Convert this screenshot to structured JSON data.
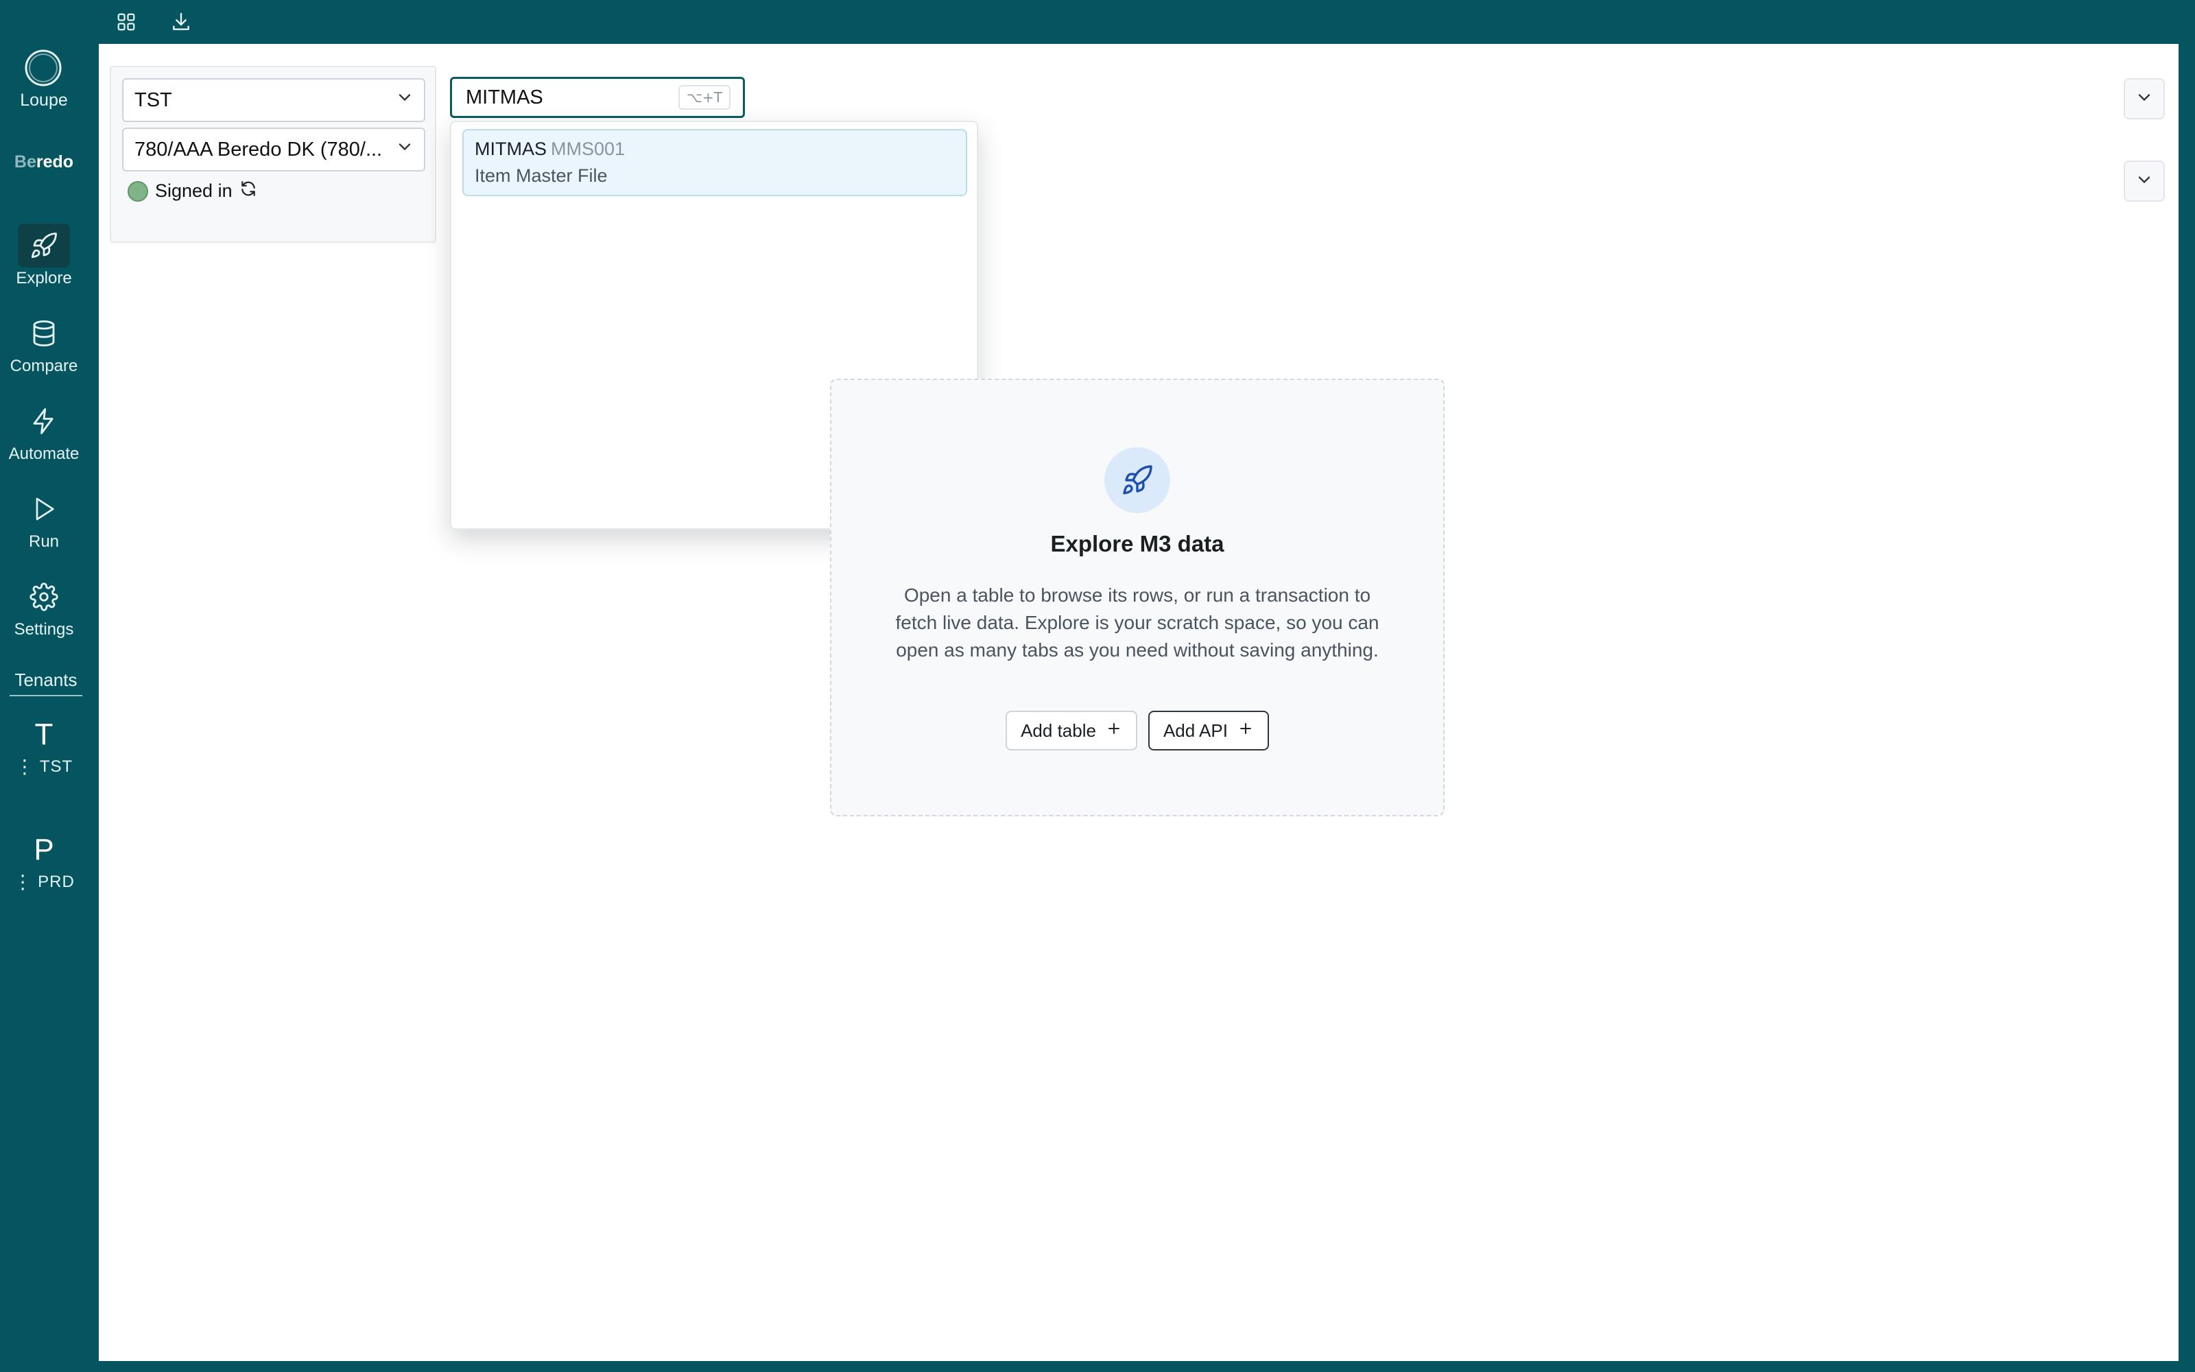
{
  "colors": {
    "brand": "#055560",
    "status_signed_in": "#7fb388",
    "selected_option_bg": "#eaf6fb"
  },
  "topbar": {
    "icons": [
      "grid-icon",
      "download-icon"
    ]
  },
  "sidebar": {
    "brand_label": "Loupe",
    "company": {
      "prefix": "Be",
      "rest": "redo"
    },
    "items": [
      {
        "label": "Explore",
        "icon": "rocket-icon",
        "active": true
      },
      {
        "label": "Compare",
        "icon": "database-icon",
        "active": false
      },
      {
        "label": "Automate",
        "icon": "lightning-icon",
        "active": false
      },
      {
        "label": "Run",
        "icon": "play-icon",
        "active": false
      },
      {
        "label": "Settings",
        "icon": "gear-icon",
        "active": false
      }
    ],
    "tenants_heading": "Tenants",
    "tenants": [
      {
        "letter": "T",
        "name": "TST"
      },
      {
        "letter": "P",
        "name": "PRD"
      }
    ]
  },
  "context": {
    "environment": "TST",
    "company_division": "780/AAA Beredo DK (780/...",
    "status": "Signed in"
  },
  "search": {
    "value": "MITMAS",
    "shortcut": "⌥+T"
  },
  "dropdown": {
    "options": [
      {
        "name": "MITMAS",
        "code": "MMS001",
        "description": "Item Master File",
        "selected": true
      }
    ]
  },
  "empty_state": {
    "title": "Explore M3 data",
    "description": "Open a table to browse its rows, or run a transaction to fetch live data. Explore is your scratch space, so you can open as many tabs as you need without saving anything.",
    "add_table_label": "Add table",
    "add_api_label": "Add API"
  }
}
